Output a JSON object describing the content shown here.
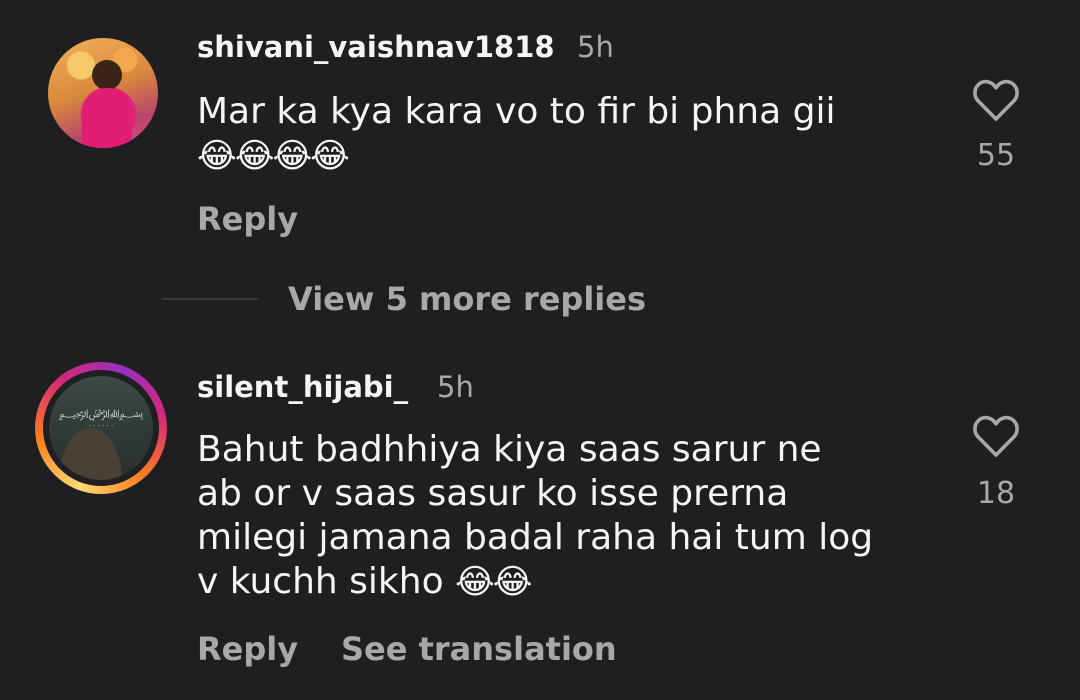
{
  "comments": [
    {
      "username": "shivani_vaishnav1818",
      "time": "5h",
      "text_lines": [
        "Mar ka kya kara vo to fir bi phna gii"
      ],
      "emoji": "😂😂😂😂",
      "likes": "55",
      "reply_label": "Reply"
    },
    {
      "username": "silent_hijabi_",
      "time": "5h",
      "text_lines": [
        "Bahut badhhiya kiya saas sarur ne",
        "ab or v saas sasur ko isse prerna",
        "milegi jamana badal raha hai tum log",
        "v kuchh sikho"
      ],
      "emoji": "😂😂",
      "likes": "18",
      "reply_label": "Reply",
      "translate_label": "See translation"
    }
  ],
  "view_more_replies": "View 5 more replies",
  "icons": {
    "like": "heart-outline-icon"
  },
  "colors": {
    "background": "#1f1f21",
    "primary_text": "#f5f5f5",
    "secondary_text": "#a8a8a8"
  }
}
